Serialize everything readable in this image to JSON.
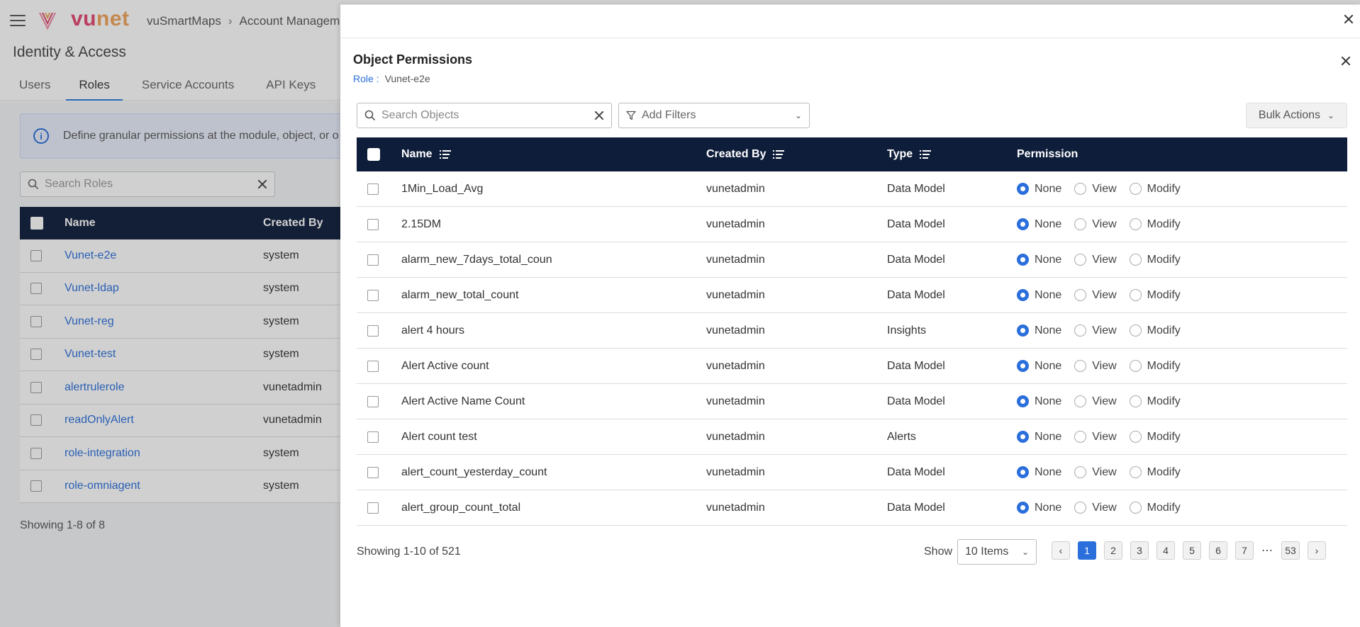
{
  "app": {
    "logo": {
      "part1": "vu",
      "part2": "net"
    },
    "breadcrumb": [
      "vuSmartMaps",
      "Account Managemer"
    ],
    "page_title": "Identity & Access",
    "tabs": [
      "Users",
      "Roles",
      "Service Accounts",
      "API Keys"
    ],
    "active_tab": "Roles",
    "info_text": "Define granular permissions at the module, object, or o",
    "search_placeholder": "Search Roles",
    "roles_table": {
      "headers": {
        "name": "Name",
        "created_by": "Created By"
      },
      "rows": [
        {
          "name": "Vunet-e2e",
          "created_by": "system"
        },
        {
          "name": "Vunet-ldap",
          "created_by": "system"
        },
        {
          "name": "Vunet-reg",
          "created_by": "system"
        },
        {
          "name": "Vunet-test",
          "created_by": "system"
        },
        {
          "name": "alertrulerole",
          "created_by": "vunetadmin"
        },
        {
          "name": "readOnlyAlert",
          "created_by": "vunetadmin"
        },
        {
          "name": "role-integration",
          "created_by": "system"
        },
        {
          "name": "role-omniagent",
          "created_by": "system"
        }
      ]
    },
    "footer_text": "Showing 1-8 of 8"
  },
  "drawer": {
    "title": "Object Permissions",
    "role_label": "Role :",
    "role_value": "Vunet-e2e",
    "search_placeholder": "Search Objects",
    "filter_label": "Add Filters",
    "bulk_actions_label": "Bulk Actions",
    "headers": {
      "name": "Name",
      "created_by": "Created By",
      "type": "Type",
      "permission": "Permission"
    },
    "permission_options": [
      "None",
      "View",
      "Modify"
    ],
    "rows": [
      {
        "name": "1Min_Load_Avg",
        "created_by": "vunetadmin",
        "type": "Data Model",
        "permission": "None"
      },
      {
        "name": "2.15DM",
        "created_by": "vunetadmin",
        "type": "Data Model",
        "permission": "None"
      },
      {
        "name": "alarm_new_7days_total_coun",
        "created_by": "vunetadmin",
        "type": "Data Model",
        "permission": "None"
      },
      {
        "name": "alarm_new_total_count",
        "created_by": "vunetadmin",
        "type": "Data Model",
        "permission": "None"
      },
      {
        "name": "alert 4 hours",
        "created_by": "vunetadmin",
        "type": "Insights",
        "permission": "None"
      },
      {
        "name": "Alert Active count",
        "created_by": "vunetadmin",
        "type": "Data Model",
        "permission": "None"
      },
      {
        "name": "Alert Active Name Count",
        "created_by": "vunetadmin",
        "type": "Data Model",
        "permission": "None"
      },
      {
        "name": "Alert count test",
        "created_by": "vunetadmin",
        "type": "Alerts",
        "permission": "None"
      },
      {
        "name": "alert_count_yesterday_count",
        "created_by": "vunetadmin",
        "type": "Data Model",
        "permission": "None"
      },
      {
        "name": "alert_group_count_total",
        "created_by": "vunetadmin",
        "type": "Data Model",
        "permission": "None"
      }
    ],
    "footer": {
      "showing": "Showing 1-10 of 521",
      "show_label": "Show",
      "page_size": "10 Items",
      "pages": [
        "1",
        "2",
        "3",
        "4",
        "5",
        "6",
        "7"
      ],
      "ellipsis": "⋯",
      "last_page": "53",
      "current_page": "1",
      "prev_icon": "‹",
      "next_icon": "›"
    }
  },
  "colors": {
    "accent": "#2a6fdb",
    "header_bg": "#0d1d3a",
    "logo_vu": "#e2456f",
    "logo_net": "#f0a35a"
  },
  "icons": [
    "hamburger-icon",
    "logo-icon",
    "info-icon",
    "search-icon",
    "clear-icon",
    "filter-icon",
    "chevron-down-icon",
    "close-icon",
    "sort-icon",
    "chevron-left-icon",
    "chevron-right-icon"
  ]
}
